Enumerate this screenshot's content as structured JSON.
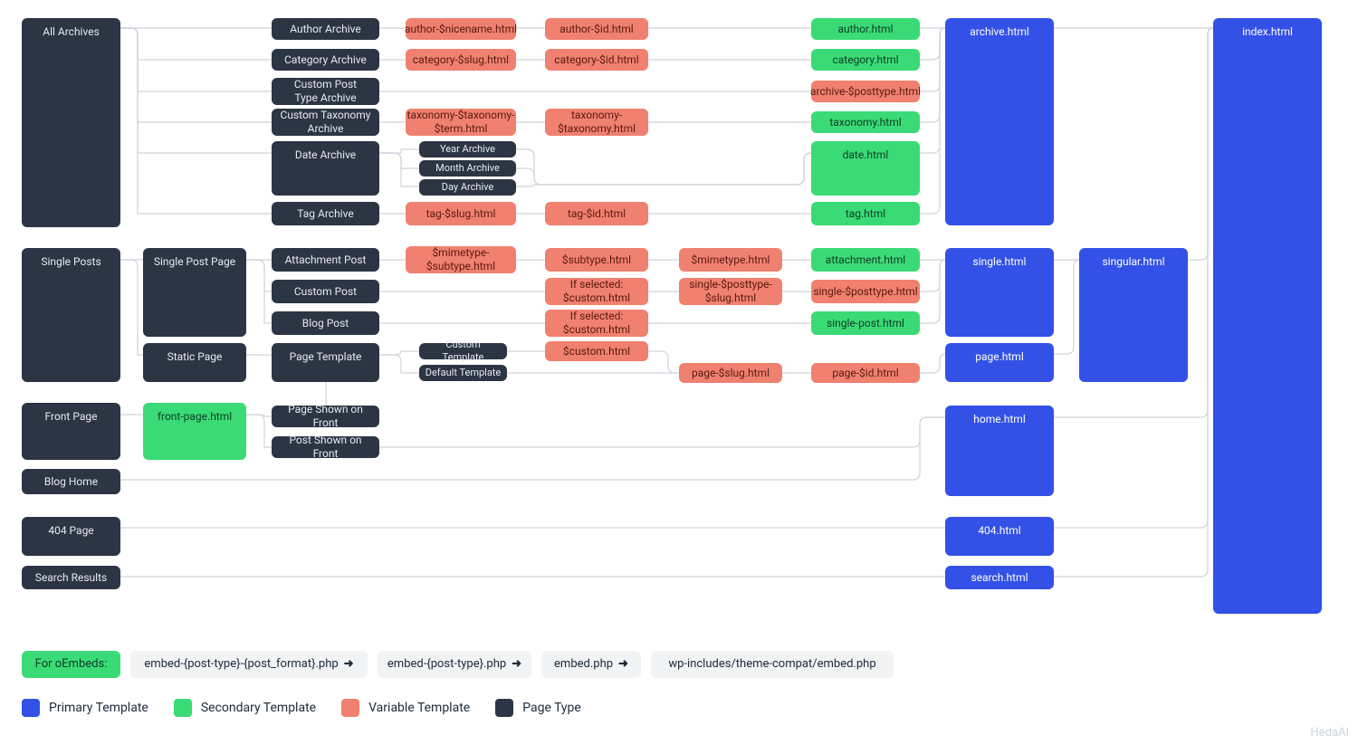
{
  "col0": {
    "all_archives": "All Archives",
    "single_posts": "Single Posts",
    "front_page": "Front Page",
    "blog_home": "Blog Home",
    "p404": "404 Page",
    "search": "Search Results"
  },
  "col1": {
    "single_post_page": "Single Post Page",
    "static_page": "Static Page",
    "front_page_html": "front-page.html"
  },
  "col2": {
    "author_archive": "Author Archive",
    "category_archive": "Category Archive",
    "custom_post_type_archive": "Custom Post\nType Archive",
    "custom_taxonomy_archive": "Custom Taxonomy\nArchive",
    "date_archive": "Date Archive",
    "tag_archive": "Tag Archive",
    "attachment_post": "Attachment Post",
    "custom_post": "Custom Post",
    "blog_post": "Blog Post",
    "page_template": "Page Template",
    "page_shown_front": "Page Shown on Front",
    "post_shown_front": "Post Shown on Front"
  },
  "col3": {
    "author_nicename": "author-$nicename.html",
    "category_slug": "category-$slug.html",
    "taxonomy_term": "taxonomy-$taxonomy-\n$term.html",
    "year_archive": "Year Archive",
    "month_archive": "Month Archive",
    "day_archive": "Day Archive",
    "tag_slug": "tag-$slug.html",
    "mimetype_subtype": "$mimetype-\n$subtype.html",
    "custom_template": "Custom Template",
    "default_template": "Default Template"
  },
  "col4": {
    "author_id": "author-$id.html",
    "category_id": "category-$id.html",
    "taxonomy_taxonomy": "taxonomy-\n$taxonomy.html",
    "tag_id": "tag-$id.html",
    "subtype": "$subtype.html",
    "if_selected_custom1": "If selected:\n$custom.html",
    "if_selected_custom2": "If selected:\n$custom.html",
    "custom_html": "$custom.html"
  },
  "col5": {
    "mimetype": "$mimetype.html",
    "single_posttype_slug": "single-$posttype-\n$slug.html",
    "page_slug": "page-$slug.html"
  },
  "col6": {
    "author": "author.html",
    "category": "category.html",
    "archive_posttype": "archive-$posttype.html",
    "taxonomy": "taxonomy.html",
    "date": "date.html",
    "tag": "tag.html",
    "attachment": "attachment.html",
    "single_posttype": "single-$posttype.html",
    "single_post": "single-post.html",
    "page_id": "page-$id.html"
  },
  "col7": {
    "archive": "archive.html",
    "single": "single.html",
    "page": "page.html",
    "home": "home.html",
    "p404": "404.html",
    "search": "search.html"
  },
  "col8": {
    "singular": "singular.html"
  },
  "col9": {
    "index": "index.html"
  },
  "embeds": {
    "label": "For oEmbeds:",
    "a": "embed-{post-type}-{post_format}.php",
    "b": "embed-{post-type}.php",
    "c": "embed.php",
    "d": "wp-includes/theme-compat/embed.php"
  },
  "legend": {
    "primary": "Primary Template",
    "secondary": "Secondary Template",
    "variable": "Variable Template",
    "pagetype": "Page Type"
  },
  "watermark": "HedaAI"
}
